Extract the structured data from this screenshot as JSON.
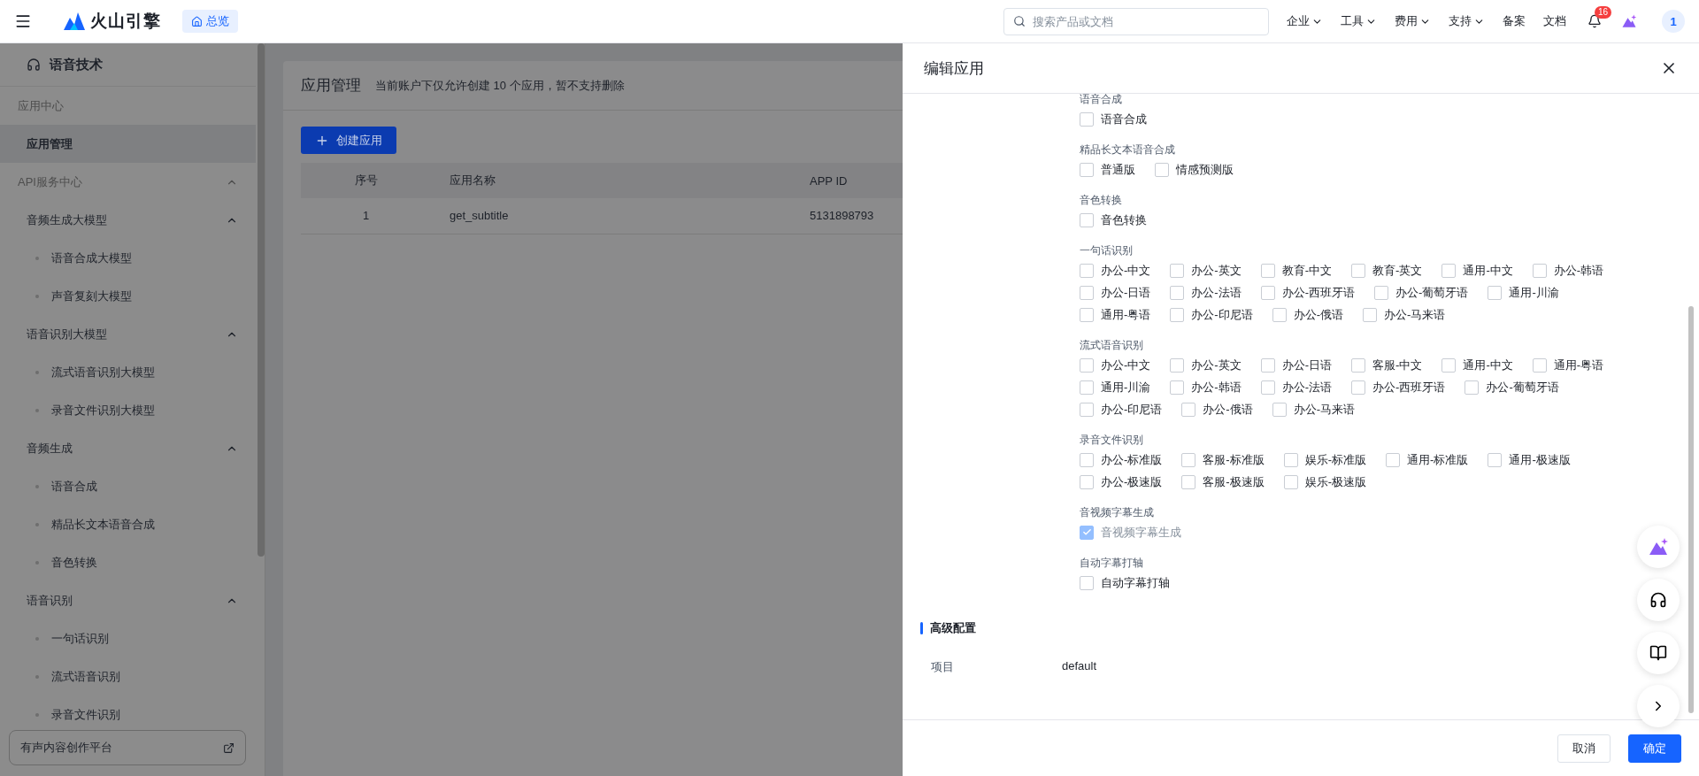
{
  "topbar": {
    "logo": "火山引擎",
    "home_tab": "总览",
    "search": {
      "placeholder": "搜索产品或文档"
    },
    "nav": [
      {
        "label": "企业",
        "dropdown": true
      },
      {
        "label": "工具",
        "dropdown": true
      },
      {
        "label": "费用",
        "dropdown": true
      },
      {
        "label": "支持",
        "dropdown": true
      },
      {
        "label": "备案",
        "dropdown": false
      },
      {
        "label": "文档",
        "dropdown": false
      }
    ],
    "notifications": "16",
    "avatar": "1"
  },
  "sidebar": {
    "title": "语音技术",
    "items": [
      {
        "kind": "heading",
        "label": "应用中心"
      },
      {
        "kind": "link",
        "label": "应用管理",
        "selected": true
      },
      {
        "kind": "group",
        "label": "API服务中心",
        "expanded": true,
        "children": [
          {
            "kind": "group",
            "label": "音频生成大模型",
            "expanded": true,
            "children": [
              {
                "kind": "leaf",
                "label": "语音合成大模型",
                "selected": false
              },
              {
                "kind": "leaf",
                "label": "声音复刻大模型",
                "selected": false
              }
            ]
          },
          {
            "kind": "group",
            "label": "语音识别大模型",
            "expanded": true,
            "children": [
              {
                "kind": "leaf",
                "label": "流式语音识别大模型",
                "selected": false
              },
              {
                "kind": "leaf",
                "label": "录音文件识别大模型",
                "selected": false
              }
            ]
          },
          {
            "kind": "group",
            "label": "音频生成",
            "expanded": true,
            "children": [
              {
                "kind": "leaf",
                "label": "语音合成",
                "selected": false
              },
              {
                "kind": "leaf",
                "label": "精品长文本语音合成",
                "selected": false
              },
              {
                "kind": "leaf",
                "label": "音色转换",
                "selected": false
              }
            ]
          },
          {
            "kind": "group",
            "label": "语音识别",
            "expanded": true,
            "children": [
              {
                "kind": "leaf",
                "label": "一句话识别",
                "selected": false
              },
              {
                "kind": "leaf",
                "label": "流式语音识别",
                "selected": false
              },
              {
                "kind": "leaf",
                "label": "录音文件识别",
                "selected": false
              }
            ]
          }
        ]
      }
    ],
    "footer_link": "有声内容创作平台"
  },
  "main": {
    "title": "应用管理",
    "note": "当前账户下仅允许创建 10 个应用，暂不支持删除",
    "create_button": "创建应用",
    "table": {
      "columns": [
        "序号",
        "应用名称",
        "APP ID"
      ],
      "rows": [
        [
          "1",
          "get_subtitle",
          "5131898793"
        ]
      ]
    }
  },
  "drawer": {
    "title": "编辑应用",
    "groups": [
      {
        "title": "语音合成",
        "options": [
          {
            "label": "语音合成",
            "checked": false,
            "disabled": false
          }
        ]
      },
      {
        "title": "精品长文本语音合成",
        "options": [
          {
            "label": "普通版",
            "checked": false,
            "disabled": false
          },
          {
            "label": "情感预测版",
            "checked": false,
            "disabled": false
          }
        ]
      },
      {
        "title": "音色转换",
        "options": [
          {
            "label": "音色转换",
            "checked": false,
            "disabled": false
          }
        ]
      },
      {
        "title": "一句话识别",
        "options": [
          {
            "label": "办公-中文",
            "checked": false,
            "disabled": false
          },
          {
            "label": "办公-英文",
            "checked": false,
            "disabled": false
          },
          {
            "label": "教育-中文",
            "checked": false,
            "disabled": false
          },
          {
            "label": "教育-英文",
            "checked": false,
            "disabled": false
          },
          {
            "label": "通用-中文",
            "checked": false,
            "disabled": false
          },
          {
            "label": "办公-韩语",
            "checked": false,
            "disabled": false
          },
          {
            "label": "办公-日语",
            "checked": false,
            "disabled": false
          },
          {
            "label": "办公-法语",
            "checked": false,
            "disabled": false
          },
          {
            "label": "办公-西班牙语",
            "checked": false,
            "disabled": false
          },
          {
            "label": "办公-葡萄牙语",
            "checked": false,
            "disabled": false
          },
          {
            "label": "通用-川渝",
            "checked": false,
            "disabled": false
          },
          {
            "label": "通用-粤语",
            "checked": false,
            "disabled": false
          },
          {
            "label": "办公-印尼语",
            "checked": false,
            "disabled": false
          },
          {
            "label": "办公-俄语",
            "checked": false,
            "disabled": false
          },
          {
            "label": "办公-马来语",
            "checked": false,
            "disabled": false
          }
        ]
      },
      {
        "title": "流式语音识别",
        "options": [
          {
            "label": "办公-中文",
            "checked": false,
            "disabled": false
          },
          {
            "label": "办公-英文",
            "checked": false,
            "disabled": false
          },
          {
            "label": "办公-日语",
            "checked": false,
            "disabled": false
          },
          {
            "label": "客服-中文",
            "checked": false,
            "disabled": false
          },
          {
            "label": "通用-中文",
            "checked": false,
            "disabled": false
          },
          {
            "label": "通用-粤语",
            "checked": false,
            "disabled": false
          },
          {
            "label": "通用-川渝",
            "checked": false,
            "disabled": false
          },
          {
            "label": "办公-韩语",
            "checked": false,
            "disabled": false
          },
          {
            "label": "办公-法语",
            "checked": false,
            "disabled": false
          },
          {
            "label": "办公-西班牙语",
            "checked": false,
            "disabled": false
          },
          {
            "label": "办公-葡萄牙语",
            "checked": false,
            "disabled": false
          },
          {
            "label": "办公-印尼语",
            "checked": false,
            "disabled": false
          },
          {
            "label": "办公-俄语",
            "checked": false,
            "disabled": false
          },
          {
            "label": "办公-马来语",
            "checked": false,
            "disabled": false
          }
        ]
      },
      {
        "title": "录音文件识别",
        "options": [
          {
            "label": "办公-标准版",
            "checked": false,
            "disabled": false
          },
          {
            "label": "客服-标准版",
            "checked": false,
            "disabled": false
          },
          {
            "label": "娱乐-标准版",
            "checked": false,
            "disabled": false
          },
          {
            "label": "通用-标准版",
            "checked": false,
            "disabled": false
          },
          {
            "label": "通用-极速版",
            "checked": false,
            "disabled": false
          },
          {
            "label": "办公-极速版",
            "checked": false,
            "disabled": false
          },
          {
            "label": "客服-极速版",
            "checked": false,
            "disabled": false
          },
          {
            "label": "娱乐-极速版",
            "checked": false,
            "disabled": false
          }
        ]
      },
      {
        "title": "音视频字幕生成",
        "options": [
          {
            "label": "音视频字幕生成",
            "checked": true,
            "disabled": true
          }
        ]
      },
      {
        "title": "自动字幕打轴",
        "options": [
          {
            "label": "自动字幕打轴",
            "checked": false,
            "disabled": false
          }
        ]
      }
    ],
    "advanced": {
      "title": "高级配置",
      "fields": [
        {
          "label": "项目",
          "value": "default"
        }
      ]
    },
    "buttons": [
      {
        "label": "取消",
        "kind": "secondary"
      },
      {
        "label": "确定",
        "kind": "primary"
      }
    ]
  }
}
